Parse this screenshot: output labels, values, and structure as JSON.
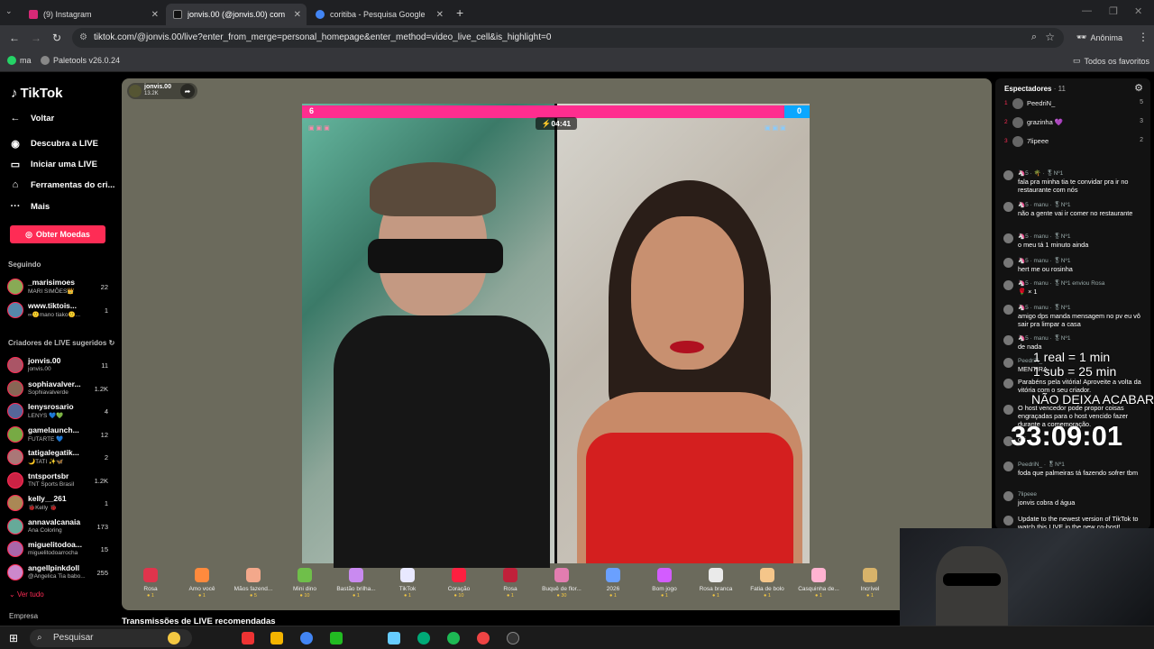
{
  "browser": {
    "tabs": [
      {
        "title": "(9) Instagram",
        "color": "#d62976"
      },
      {
        "title": "jonvis.00 (@jonvis.00) com",
        "color": "#111111"
      },
      {
        "title": "coritiba - Pesquisa Google",
        "color": "#4285f4"
      }
    ],
    "url": "tiktok.com/@jonvis.00/live?enter_from_merge=personal_homepage&enter_method=video_live_cell&is_highlight=0",
    "profile_label": "Anônima",
    "bookmarks": [
      "ma",
      "Paletools v26.0.24"
    ],
    "all_favorites": "Todos os favoritos"
  },
  "sidebar": {
    "brand": "TikTok",
    "back": "Voltar",
    "nav": [
      "Descubra a LIVE",
      "Iniciar uma LIVE",
      "Ferramentas do cri...",
      "Mais"
    ],
    "coins_button": "Obter Moedas",
    "following_title": "Seguindo",
    "following": [
      {
        "name": "_marisimoes",
        "sub": "MARI SIMÕES👑",
        "count": "22"
      },
      {
        "name": "www.tiktois...",
        "sub": "∞🙂mano tiako🙂...",
        "count": "1"
      }
    ],
    "suggested_title": "Criadores de LIVE sugeridos",
    "suggested": [
      {
        "name": "jonvis.00",
        "sub": "jonvis.00",
        "count": "11"
      },
      {
        "name": "sophiavalver...",
        "sub": "Sophiavalverde",
        "count": "1.2K"
      },
      {
        "name": "lenysrosario",
        "sub": "LENYS 💙💚",
        "count": "4"
      },
      {
        "name": "gamelaunch...",
        "sub": "FUTARTE 💙",
        "count": "12"
      },
      {
        "name": "tatigalegatik...",
        "sub": "🌙TATI ✨🦋",
        "count": "2"
      },
      {
        "name": "tntsportsbr",
        "sub": "TNT Sports Brasil",
        "count": "1.2K"
      },
      {
        "name": "kelly__261",
        "sub": "🐞Kelly 🐞",
        "count": "1"
      },
      {
        "name": "annavalcanaia",
        "sub": "Ana Coloring",
        "count": "173"
      },
      {
        "name": "miguelitodoa...",
        "sub": "miguelitodoarrocha",
        "count": "15"
      },
      {
        "name": "angelIpinkdoll",
        "sub": "@Angelica Tia babo...",
        "count": "255"
      }
    ],
    "see_all": "Ver tudo",
    "company": "Empresa"
  },
  "live": {
    "host_name": "jonvis.00",
    "host_viewers": "13.2K",
    "score_left": "6",
    "score_right": "0",
    "timer": "04:41",
    "score_left_fraction": 0.95
  },
  "gifts": [
    {
      "name": "Rosa",
      "price": "1",
      "color": "#e0344c"
    },
    {
      "name": "Amo você",
      "price": "1",
      "color": "#ff8a3d"
    },
    {
      "name": "Mãos fazend...",
      "price": "5",
      "color": "#f3a88b"
    },
    {
      "name": "Mini dino",
      "price": "10",
      "color": "#6fbf4a"
    },
    {
      "name": "Bastão brilha...",
      "price": "1",
      "color": "#c98af0"
    },
    {
      "name": "TikTok",
      "price": "1",
      "color": "#e8e8ff"
    },
    {
      "name": "Coração",
      "price": "10",
      "color": "#ff2040"
    },
    {
      "name": "Rosa",
      "price": "1",
      "color": "#c0203a"
    },
    {
      "name": "Buquê de flor...",
      "price": "30",
      "color": "#e27db0"
    },
    {
      "name": "2026",
      "price": "1",
      "color": "#6aa0ff"
    },
    {
      "name": "Bom jogo",
      "price": "1",
      "color": "#d35cff"
    },
    {
      "name": "Rosa branca",
      "price": "1",
      "color": "#eaeaea"
    },
    {
      "name": "Fatia de bolo",
      "price": "1",
      "color": "#f5c68a"
    },
    {
      "name": "Casquinha de...",
      "price": "1",
      "color": "#ffb3d1"
    },
    {
      "name": "Incrível",
      "price": "1",
      "color": "#d8b36a"
    }
  ],
  "recommended_title": "Transmissões de LIVE recomendadas",
  "viewers_panel": {
    "title": "Espectadores",
    "count": "· 11",
    "top": [
      {
        "rank": "1",
        "name": "PeedriN_",
        "score": "5"
      },
      {
        "rank": "2",
        "name": "grazinha 💜",
        "score": "3"
      },
      {
        "rank": "3",
        "name": "7lipeee",
        "score": "2"
      }
    ]
  },
  "chat": [
    {
      "name": "🦄5 · 🌴 · 🎖Nº1",
      "text": "fala pra minha tia te convidar pra ir no restaurante com nós"
    },
    {
      "name": "🦄5 · manu · 🎖Nº1",
      "text": "não a gente vai ir comer no restaurante"
    },
    {
      "name": "🦄5 · manu · 🎖Nº1",
      "text": "o meu tá 1 minuto ainda"
    },
    {
      "name": "🦄5 · manu · 🎖Nº1",
      "text": "hert me ou rosinha"
    },
    {
      "name": "🦄5 · manu · 🎖Nº1 enviou Rosa",
      "text": "🌹 × 1"
    },
    {
      "name": "🦄5 · manu · 🎖Nº1",
      "text": "amigo dps manda mensagem no pv eu vô sair pra limpar a casa"
    },
    {
      "name": "🦄5 · manu · 🎖Nº1",
      "text": "de nada"
    },
    {
      "name": "PeedriN_",
      "text": "MENTIRA"
    },
    {
      "name": "",
      "text": "Parabéns pela vitória! Aproveite a volta da vitória com o seu criador."
    },
    {
      "name": "",
      "text": "O host vencedor pode propor coisas engraçadas para o host vencido fazer durante a comemoração."
    },
    {
      "name": "",
      "text": "oiii"
    },
    {
      "name": "PeedriN_ · 🎖Nº1",
      "text": "foda que palmeiras tá fazendo sofrer tbm"
    },
    {
      "name": "7lipeee",
      "text": "jonvis cobra d água"
    },
    {
      "name": "",
      "text": "Update to the newest version of TikTok to watch this LIVE in the new co-host!"
    }
  ],
  "overlay": {
    "line1": "1 real = 1 min",
    "line2": "1 sub = 25 min",
    "line3": "NÃO DEIXA ACABAR",
    "countdown": "33:09:01"
  },
  "taskbar": {
    "search_placeholder": "Pesquisar"
  }
}
